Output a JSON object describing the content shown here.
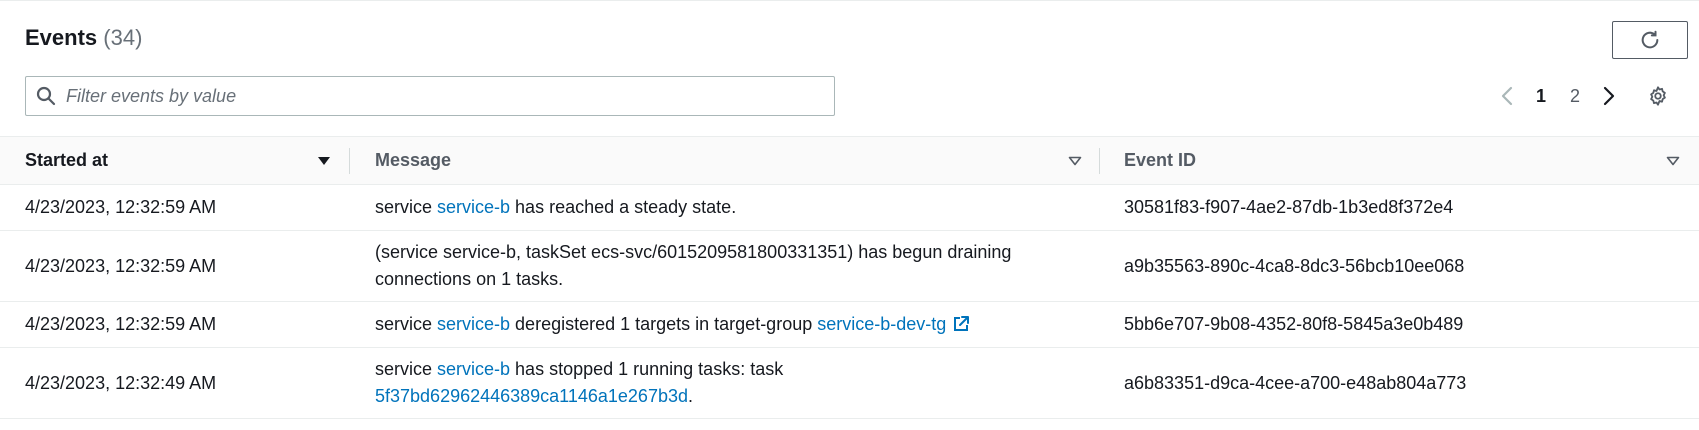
{
  "header": {
    "title": "Events",
    "count": "(34)"
  },
  "filter": {
    "placeholder": "Filter events by value",
    "value": ""
  },
  "pagination": {
    "pages": [
      "1",
      "2"
    ],
    "current": "1"
  },
  "icons": {
    "refresh": "refresh-icon",
    "search": "search-icon",
    "prev": "chevron-left-icon",
    "next": "chevron-right-icon",
    "settings": "gear-icon",
    "external": "external-link-icon"
  },
  "colors": {
    "link": "#0073bb",
    "text": "#16191f",
    "muted": "#687078"
  },
  "table": {
    "columns": [
      "Started at",
      "Message",
      "Event ID"
    ],
    "rows": [
      {
        "started_at": "4/23/2023, 12:32:59 AM",
        "message": [
          {
            "text": "service "
          },
          {
            "text": "service-b",
            "link": true
          },
          {
            "text": " has reached a steady state."
          }
        ],
        "event_id": "30581f83-f907-4ae2-87db-1b3ed8f372e4"
      },
      {
        "started_at": "4/23/2023, 12:32:59 AM",
        "message": [
          {
            "text": "(service service-b, taskSet ecs-svc/6015209581800331351) has begun draining connections on 1 tasks."
          }
        ],
        "event_id": "a9b35563-890c-4ca8-8dc3-56bcb10ee068"
      },
      {
        "started_at": "4/23/2023, 12:32:59 AM",
        "message": [
          {
            "text": "service "
          },
          {
            "text": "service-b",
            "link": true
          },
          {
            "text": " deregistered 1 targets in target-group "
          },
          {
            "text": "service-b-dev-tg",
            "link": true,
            "external": true
          }
        ],
        "event_id": "5bb6e707-9b08-4352-80f8-5845a3e0b489"
      },
      {
        "started_at": "4/23/2023, 12:32:49 AM",
        "message": [
          {
            "text": "service "
          },
          {
            "text": "service-b",
            "link": true
          },
          {
            "text": " has stopped 1 running tasks: task "
          },
          {
            "text": "5f37bd62962446389ca1146a1e267b3d",
            "link": true
          },
          {
            "text": "."
          }
        ],
        "event_id": "a6b83351-d9ca-4cee-a700-e48ab804a773"
      }
    ]
  }
}
